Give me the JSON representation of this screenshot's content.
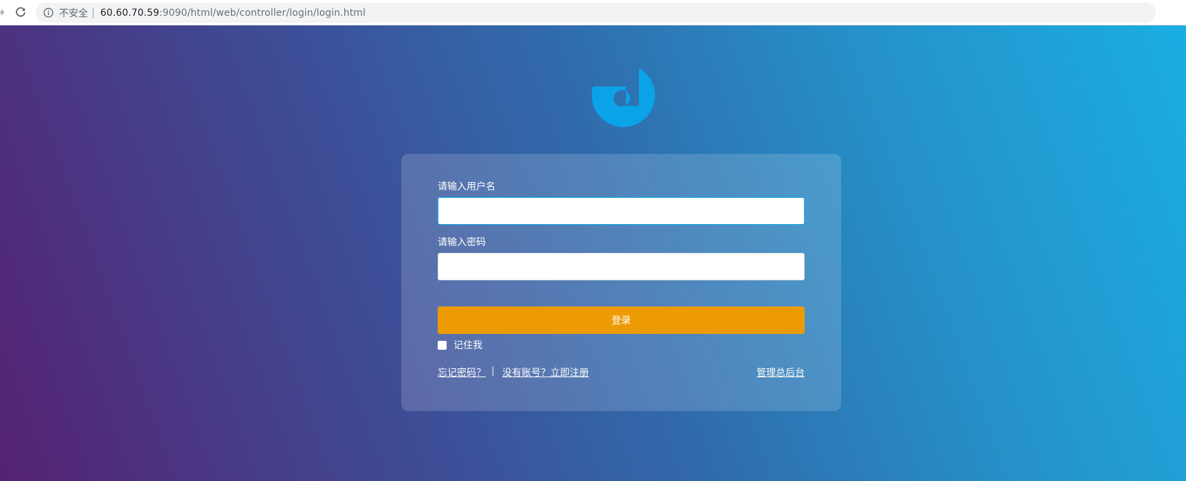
{
  "browser": {
    "security_label": "不安全",
    "url_host": "60.60.70.59",
    "url_rest": ":9090/html/web/controller/login/login.html",
    "icons": [
      "forward-arrow-icon",
      "reload-icon",
      "info-icon"
    ]
  },
  "logo": {
    "icon": "brand-logo-icon",
    "color": "#0aa3e8"
  },
  "login_form": {
    "username_label": "请输入用户名",
    "username_value": "",
    "password_label": "请输入密码",
    "password_value": "",
    "submit_label": "登录",
    "remember_label": "记住我",
    "remember_checked": false,
    "forgot_link": "忘记密码？",
    "separator": "|",
    "register_link": "没有账号？立即注册",
    "admin_link": "管理总后台"
  },
  "colors": {
    "button": "#ec9b05",
    "focus_border": "#1aaee2",
    "gradient_start": "#552272",
    "gradient_end": "#1aaee2"
  }
}
